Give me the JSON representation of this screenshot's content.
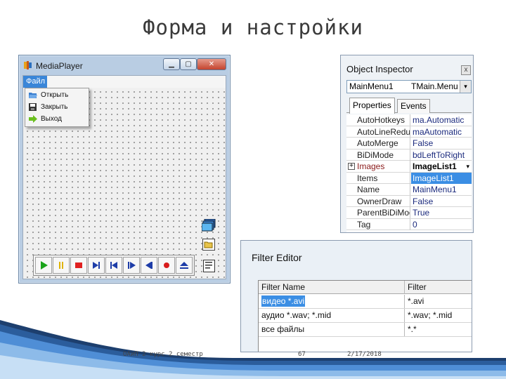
{
  "slide": {
    "title": "Форма и настройки",
    "footer": {
      "left": "ОАиП 2 курс 2 семестр",
      "page": "67",
      "date": "2/17/2018"
    }
  },
  "media_player": {
    "window_title": "MediaPlayer",
    "caption_buttons": {
      "minimize": "▁",
      "maximize": "▢",
      "close": "✕"
    },
    "menu_file": "Файл",
    "menu_items": [
      {
        "label": "Открыть",
        "icon": "folder-open-icon"
      },
      {
        "label": "Закрыть",
        "icon": "floppy-icon"
      },
      {
        "label": "Выход",
        "icon": "exit-arrow-icon"
      }
    ],
    "components": [
      "imagelist-icon",
      "opendialog-icon",
      "memo-icon"
    ],
    "media_buttons": [
      "play",
      "pause",
      "stop",
      "next",
      "prev",
      "step",
      "back",
      "record",
      "eject"
    ],
    "colors": {
      "play": "#1aa31a",
      "pause": "#e0b300",
      "stop": "#e02020",
      "nav": "#1e3da8",
      "record": "#d81c1c"
    }
  },
  "object_inspector": {
    "title": "Object Inspector",
    "close_glyph": "x",
    "component_name": "MainMenu1",
    "component_type": "TMain.Menu",
    "combo_arrow": "▾",
    "tabs": [
      "Properties",
      "Events"
    ],
    "properties": [
      {
        "key": "AutoHotkeys",
        "value": "ma.Automatic"
      },
      {
        "key": "AutoLineReduc",
        "value": "maAutomatic"
      },
      {
        "key": "AutoMerge",
        "value": "False"
      },
      {
        "key": "BiDiMode",
        "value": "bdLeftToRight"
      },
      {
        "key": "Images",
        "value": "ImageList1"
      },
      {
        "key": "Items",
        "value": "ImageList1"
      },
      {
        "key": "Name",
        "value": "MainMenu1"
      },
      {
        "key": "OwnerDraw",
        "value": "False"
      },
      {
        "key": "ParentBiDiMod",
        "value": "True"
      },
      {
        "key": "Tag",
        "value": "0"
      }
    ],
    "images_expand": "+",
    "images_arrow": "▾"
  },
  "filter_editor": {
    "title": "Filter Editor",
    "columns": [
      "Filter Name",
      "Filter"
    ],
    "rows": [
      {
        "name": "видео *.avi",
        "filter": "*.avi"
      },
      {
        "name": "аудио *.wav; *.mid",
        "filter": "*.wav; *.mid"
      },
      {
        "name": "все файлы",
        "filter": "*.*"
      }
    ]
  }
}
